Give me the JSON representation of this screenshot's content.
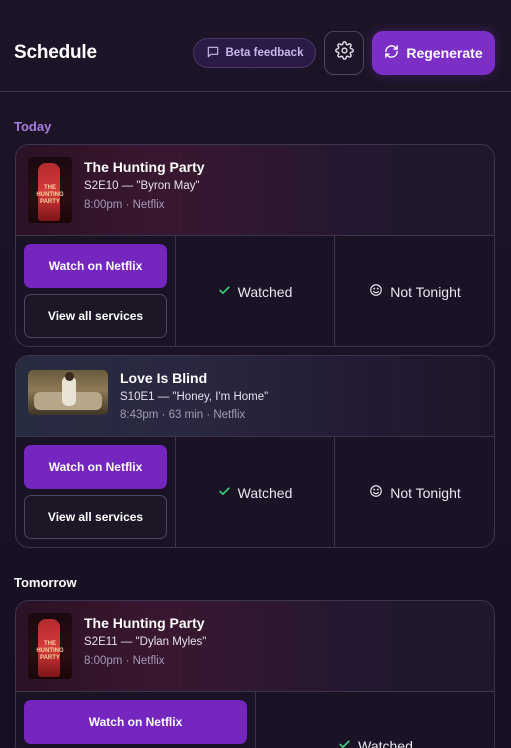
{
  "header": {
    "title": "Schedule",
    "beta_label": "Beta feedback",
    "regenerate_label": "Regenerate"
  },
  "sections": {
    "today": "Today",
    "tomorrow": "Tomorrow"
  },
  "cards": [
    {
      "title": "The Hunting Party",
      "episode": "S2E10 — \"Byron May\"",
      "time": "8:00pm",
      "service": "· Netflix",
      "watch_label": "Watch on Netflix",
      "services_label": "View all services",
      "watched_label": "Watched",
      "not_tonight_label": "Not Tonight"
    },
    {
      "title": "Love Is Blind",
      "episode": "S10E1 — \"Honey, I'm Home\"",
      "time": "8:43pm",
      "runtime": "· 63 min",
      "service": "· Netflix",
      "watch_label": "Watch on Netflix",
      "services_label": "View all services",
      "watched_label": "Watched",
      "not_tonight_label": "Not Tonight"
    },
    {
      "title": "The Hunting Party",
      "episode": "S2E11 — \"Dylan Myles\"",
      "time": "8:00pm",
      "service": "· Netflix",
      "watch_label": "Watch on Netflix",
      "watched_label": "Watched"
    }
  ],
  "poster_text": "THE HUNTING PARTY",
  "icons": {
    "beta": "message-square-icon",
    "settings": "gear-icon",
    "regenerate": "refresh-icon",
    "watched": "check-icon",
    "not_tonight": "smile-icon"
  },
  "colors": {
    "accent": "#7b2fc6",
    "today_label": "#a77de0",
    "watched_check": "#3fcf7a"
  }
}
